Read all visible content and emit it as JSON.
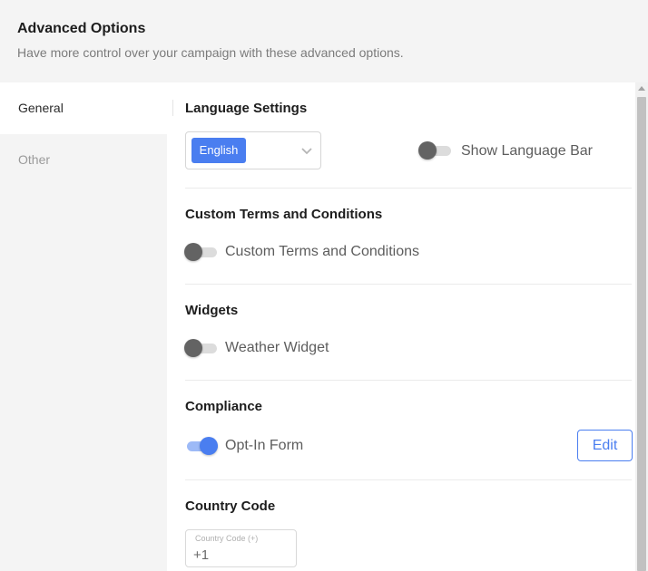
{
  "header": {
    "title": "Advanced Options",
    "subtitle": "Have more control over your campaign with these advanced options."
  },
  "sidebar": {
    "items": [
      {
        "label": "General",
        "active": true
      },
      {
        "label": "Other",
        "active": false
      }
    ]
  },
  "language": {
    "title": "Language Settings",
    "selected": "English",
    "dropdown_icon": "chevron-down-icon",
    "toggle_label": "Show Language Bar",
    "toggle_on": false
  },
  "terms": {
    "title": "Custom Terms and Conditions",
    "toggle_label": "Custom Terms and Conditions",
    "toggle_on": false
  },
  "widgets": {
    "title": "Widgets",
    "toggle_label": "Weather Widget",
    "toggle_on": false
  },
  "compliance": {
    "title": "Compliance",
    "toggle_label": "Opt-In Form",
    "toggle_on": true,
    "edit_label": "Edit"
  },
  "country": {
    "title": "Country Code",
    "field_label": "Country Code (+)",
    "value": "+1"
  },
  "colors": {
    "accent": "#4a7ef0",
    "toggle_off_knob": "#636363",
    "panel_bg": "#f4f4f4"
  }
}
